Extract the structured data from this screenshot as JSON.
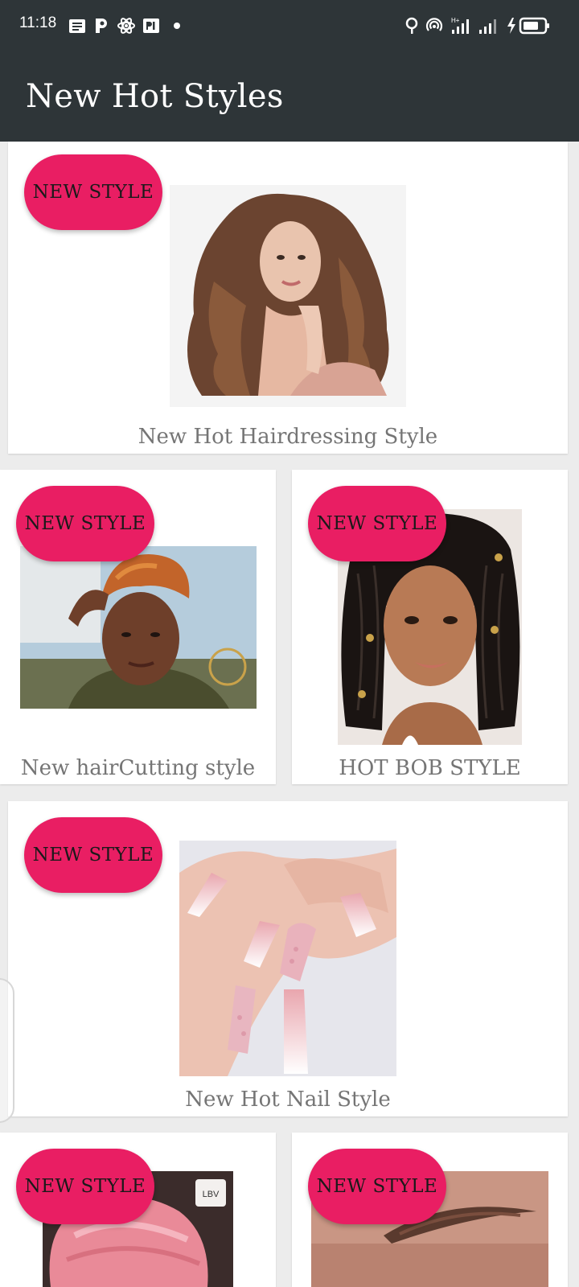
{
  "status_bar": {
    "time": "11:18",
    "icons": [
      "news-icon",
      "p-icon",
      "atom-icon",
      "pp-icon",
      "dot-icon",
      "location-icon",
      "hotspot-icon",
      "signal-h-plus-icon",
      "signal-icon",
      "battery-charging-icon"
    ]
  },
  "app_bar": {
    "title": "New Hot Styles"
  },
  "colors": {
    "app_bar": "#2e3538",
    "badge": "#e91e63",
    "caption": "#757575",
    "background": "#ececec"
  },
  "cards": [
    {
      "badge": "NEW STYLE",
      "caption": "New Hot Hairdressing Style",
      "image": "long-wavy-hair-woman-photo"
    },
    {
      "badge": "NEW STYLE",
      "caption": "New hairCutting style",
      "image": "short-copper-hair-woman-photo"
    },
    {
      "badge": "NEW STYLE",
      "caption": "HOT BOB STYLE",
      "image": "braided-bob-woman-photo"
    },
    {
      "badge": "NEW STYLE",
      "caption": "New Hot Nail Style",
      "image": "ombre-nails-photo"
    },
    {
      "badge": "NEW STYLE",
      "caption": "",
      "image": "pink-headwrap-photo"
    },
    {
      "badge": "NEW STYLE",
      "caption": "",
      "image": "eyebrow-closeup-photo"
    }
  ]
}
